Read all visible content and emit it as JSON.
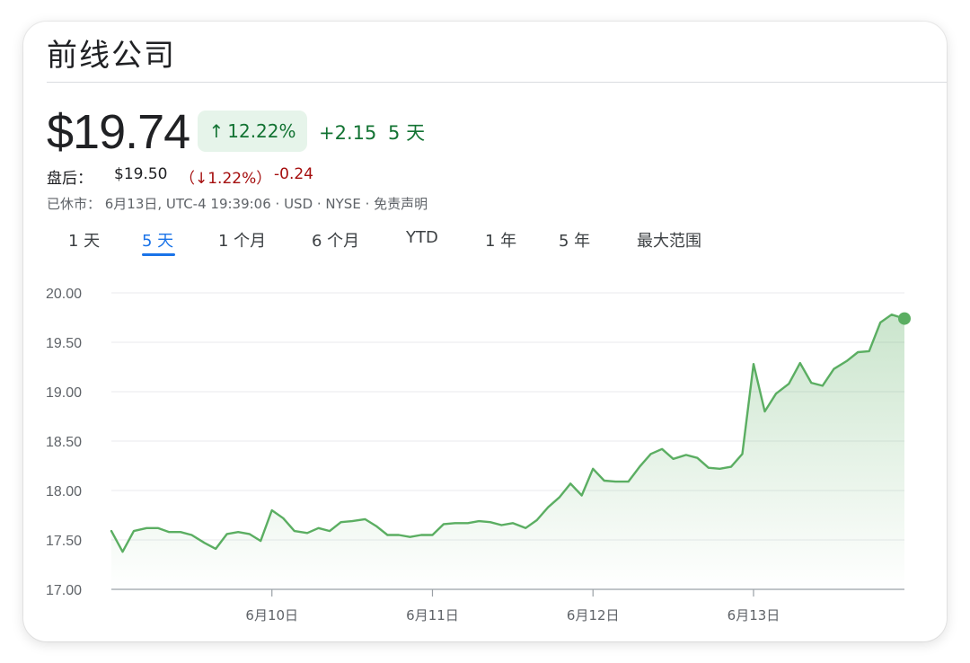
{
  "header": {
    "company": "前线公司"
  },
  "quote": {
    "price": "$19.74",
    "change_pct": "12.22%",
    "change_abs": "+2.15",
    "period": "5 天",
    "after_hours_label": "盘后：",
    "after_hours_price": "$19.50",
    "after_hours_pct": "（↓1.22%）",
    "after_hours_abs": "-0.24",
    "meta_line": "已休市：  6月13日, UTC-4 19:39:06 · USD · NYSE · 免责声明"
  },
  "tabs": [
    {
      "label": "1 天"
    },
    {
      "label": "5 天"
    },
    {
      "label": "1 个月"
    },
    {
      "label": "6 个月"
    },
    {
      "label": "YTD"
    },
    {
      "label": "1 年"
    },
    {
      "label": "5 年"
    },
    {
      "label": "最大范围"
    }
  ],
  "active_tab": 1,
  "colors": {
    "positive": "#137333",
    "negative": "#a50e0e",
    "line": "#5bae62",
    "accent": "#1a73e8"
  },
  "chart_data": {
    "type": "area",
    "title": "",
    "xlabel": "",
    "ylabel": "",
    "ylim": [
      17.0,
      20.0
    ],
    "yticks": [
      17.0,
      17.5,
      18.0,
      18.5,
      19.0,
      19.5,
      20.0
    ],
    "ytick_labels": [
      "17.00",
      "17.50",
      "18.00",
      "18.50",
      "19.00",
      "19.50",
      "20.00"
    ],
    "xlim": [
      0,
      4.94
    ],
    "xticks": [
      1,
      2,
      3,
      4
    ],
    "xtick_labels": [
      "6月10日",
      "6月11日",
      "6月12日",
      "6月13日"
    ],
    "grid": true,
    "series": [
      {
        "name": "",
        "x": [
          0,
          0.07,
          0.14,
          0.22,
          0.29,
          0.36,
          0.43,
          0.5,
          0.58,
          0.65,
          0.72,
          0.79,
          0.86,
          0.93,
          1.0,
          1.07,
          1.14,
          1.22,
          1.29,
          1.36,
          1.43,
          1.5,
          1.58,
          1.65,
          1.72,
          1.79,
          1.86,
          1.93,
          2.0,
          2.07,
          2.14,
          2.22,
          2.29,
          2.36,
          2.43,
          2.5,
          2.58,
          2.65,
          2.72,
          2.79,
          2.86,
          2.93,
          3.0,
          3.07,
          3.14,
          3.22,
          3.29,
          3.36,
          3.43,
          3.5,
          3.58,
          3.65,
          3.72,
          3.79,
          3.86,
          3.93,
          4.0,
          4.07,
          4.14,
          4.22,
          4.29,
          4.36,
          4.43,
          4.5,
          4.58,
          4.65,
          4.72,
          4.79,
          4.86,
          4.94
        ],
        "y": [
          17.59,
          17.38,
          17.59,
          17.62,
          17.62,
          17.58,
          17.58,
          17.55,
          17.47,
          17.41,
          17.56,
          17.58,
          17.56,
          17.49,
          17.8,
          17.72,
          17.59,
          17.57,
          17.62,
          17.59,
          17.68,
          17.69,
          17.71,
          17.64,
          17.55,
          17.55,
          17.53,
          17.55,
          17.55,
          17.66,
          17.67,
          17.67,
          17.69,
          17.68,
          17.65,
          17.67,
          17.62,
          17.7,
          17.83,
          17.93,
          18.07,
          17.95,
          18.22,
          18.1,
          18.09,
          18.09,
          18.24,
          18.37,
          18.42,
          18.32,
          18.36,
          18.33,
          18.23,
          18.22,
          18.24,
          18.37,
          19.28,
          18.8,
          18.98,
          19.08,
          19.29,
          19.09,
          19.06,
          19.23,
          19.31,
          19.4,
          19.41,
          19.7,
          19.78,
          19.74
        ]
      }
    ]
  }
}
